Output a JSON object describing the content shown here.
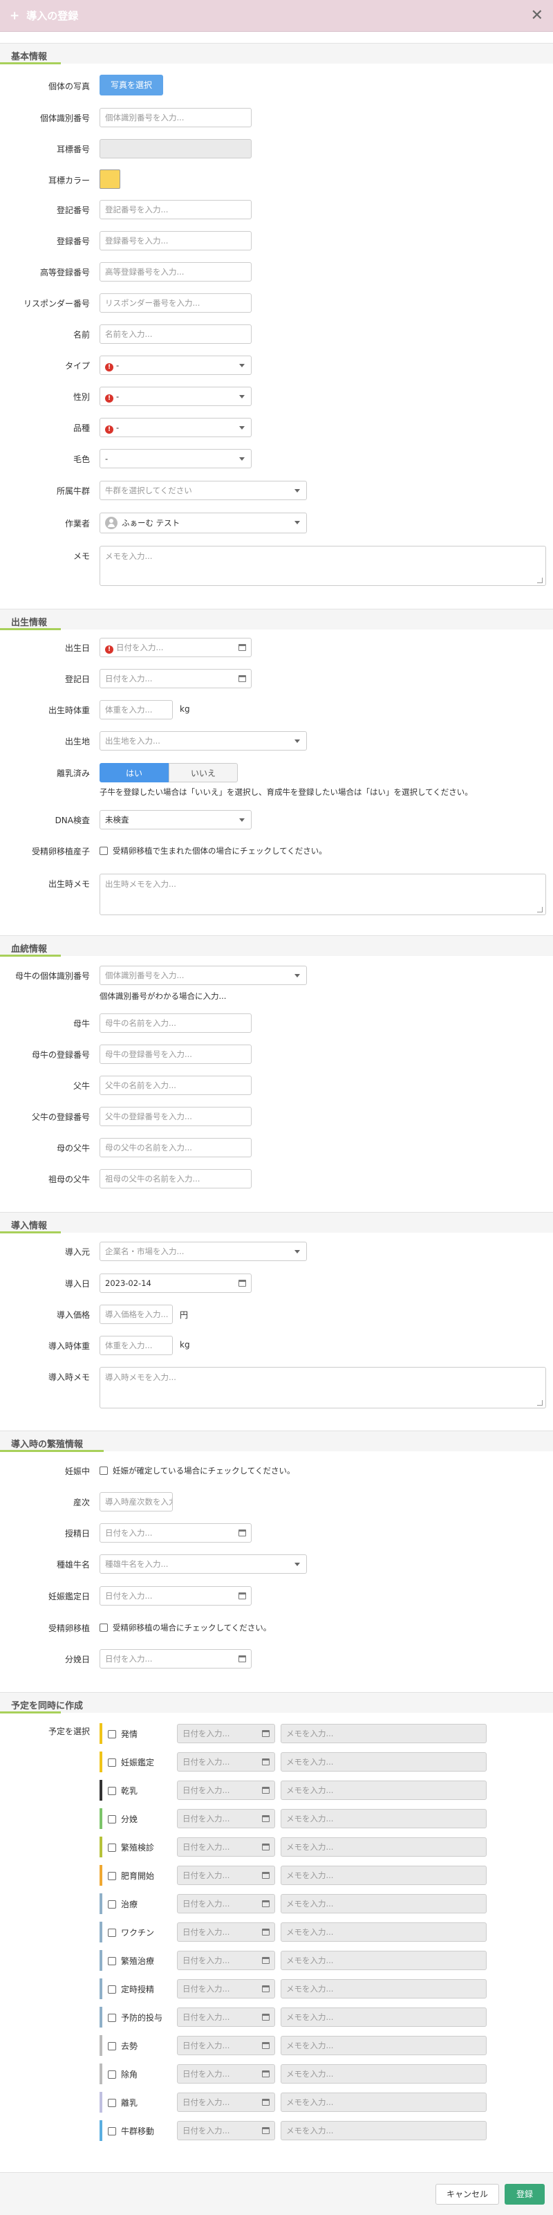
{
  "header": {
    "title": "導入の登録",
    "plus_glyph": "+",
    "close_glyph": "✕"
  },
  "sections": {
    "basic": "基本情報",
    "birth": "出生情報",
    "lineage": "血統情報",
    "intro": "導入情報",
    "breeding": "導入時の繁殖情報",
    "schedule": "予定を同時に作成"
  },
  "basic": {
    "photo_label": "個体の写真",
    "photo_button": "写真を選択",
    "id_label": "個体識別番号",
    "id_placeholder": "個体識別番号を入力...",
    "eartag_label": "耳標番号",
    "eartag_color_label": "耳標カラー",
    "reg_label": "登記番号",
    "reg_placeholder": "登記番号を入力...",
    "registration_label": "登録番号",
    "registration_placeholder": "登録番号を入力...",
    "high_reg_label": "高等登録番号",
    "high_reg_placeholder": "高等登録番号を入力...",
    "resp_label": "リスポンダー番号",
    "resp_placeholder": "リスポンダー番号を入力...",
    "name_label": "名前",
    "name_placeholder": "名前を入力...",
    "type_label": "タイプ",
    "type_value": "-",
    "sex_label": "性別",
    "sex_value": "-",
    "breed_label": "品種",
    "breed_value": "-",
    "coat_label": "毛色",
    "coat_value": "-",
    "herd_label": "所属牛群",
    "herd_placeholder": "牛群を選択してください",
    "worker_label": "作業者",
    "worker_value": "ふぁーむ テスト",
    "memo_label": "メモ",
    "memo_placeholder": "メモを入力..."
  },
  "birth": {
    "birth_date_label": "出生日",
    "birth_date_placeholder": "日付を入力...",
    "reg_date_label": "登記日",
    "reg_date_placeholder": "日付を入力...",
    "weight_label": "出生時体重",
    "weight_placeholder": "体重を入力...",
    "weight_unit": "kg",
    "place_label": "出生地",
    "place_placeholder": "出生地を入力...",
    "weaned_label": "離乳済み",
    "yes": "はい",
    "no": "いいえ",
    "weaned_help": "子牛を登録したい場合は「いいえ」を選択し、育成牛を登録したい場合は「はい」を選択してください。",
    "dna_label": "DNA検査",
    "dna_value": "未検査",
    "et_label": "受精卵移植産子",
    "et_check": "受精卵移植で生まれた個体の場合にチェックしてください。",
    "memo_label": "出生時メモ",
    "memo_placeholder": "出生時メモを入力..."
  },
  "lineage": {
    "dam_id_label": "母牛の個体識別番号",
    "dam_id_placeholder": "個体識別番号を入力...",
    "dam_id_help": "個体識別番号がわかる場合に入力...",
    "dam_label": "母牛",
    "dam_placeholder": "母牛の名前を入力...",
    "dam_reg_label": "母牛の登録番号",
    "dam_reg_placeholder": "母牛の登録番号を入力...",
    "sire_label": "父牛",
    "sire_placeholder": "父牛の名前を入力...",
    "sire_reg_label": "父牛の登録番号",
    "sire_reg_placeholder": "父牛の登録番号を入力...",
    "dam_sire_label": "母の父牛",
    "dam_sire_placeholder": "母の父牛の名前を入力...",
    "gdam_sire_label": "祖母の父牛",
    "gdam_sire_placeholder": "祖母の父牛の名前を入力..."
  },
  "intro": {
    "source_label": "導入元",
    "source_placeholder": "企業名・市場を入力...",
    "date_label": "導入日",
    "date_value": "2023-02-14",
    "price_label": "導入価格",
    "price_placeholder": "導入価格を入力...",
    "price_unit": "円",
    "weight_label": "導入時体重",
    "weight_placeholder": "体重を入力...",
    "weight_unit": "kg",
    "memo_label": "導入時メモ",
    "memo_placeholder": "導入時メモを入力..."
  },
  "breeding": {
    "pregnant_label": "妊娠中",
    "pregnant_check": "妊娠が確定している場合にチェックしてください。",
    "parity_label": "産次",
    "parity_placeholder": "導入時産次数を入力...",
    "insem_label": "授精日",
    "insem_placeholder": "日付を入力...",
    "bull_label": "種雄牛名",
    "bull_placeholder": "種雄牛名を入力...",
    "preg_date_label": "妊娠鑑定日",
    "preg_date_placeholder": "日付を入力...",
    "et_label": "受精卵移植",
    "et_check": "受精卵移植の場合にチェックしてください。",
    "calving_label": "分娩日",
    "calving_placeholder": "日付を入力..."
  },
  "schedule": {
    "label": "予定を選択",
    "date_placeholder": "日付を入力...",
    "memo_placeholder": "メモを入力...",
    "items": [
      {
        "name": "発情",
        "color": "#f0c419"
      },
      {
        "name": "妊娠鑑定",
        "color": "#f0c419"
      },
      {
        "name": "乾乳",
        "color": "#333333"
      },
      {
        "name": "分娩",
        "color": "#7cc46a"
      },
      {
        "name": "繁殖検診",
        "color": "#b6c23a"
      },
      {
        "name": "肥育開始",
        "color": "#f0a832"
      },
      {
        "name": "治療",
        "color": "#8fb0c8"
      },
      {
        "name": "ワクチン",
        "color": "#8fb0c8"
      },
      {
        "name": "繁殖治療",
        "color": "#8fb0c8"
      },
      {
        "name": "定時授精",
        "color": "#8fb0c8"
      },
      {
        "name": "予防的投与",
        "color": "#8fb0c8"
      },
      {
        "name": "去勢",
        "color": "#bbbbbb"
      },
      {
        "name": "除角",
        "color": "#bbbbbb"
      },
      {
        "name": "離乳",
        "color": "#c0c0e0"
      },
      {
        "name": "牛群移動",
        "color": "#5aaee0"
      }
    ]
  },
  "footer": {
    "cancel": "キャンセル",
    "save": "登録"
  },
  "colors": {
    "header_bg": "#ead4dc",
    "section_accent": "#a8d05a",
    "primary": "#5fa5ea",
    "save": "#3aa879",
    "eartag_color": "#f9d35a",
    "warn": "#d9342b"
  }
}
